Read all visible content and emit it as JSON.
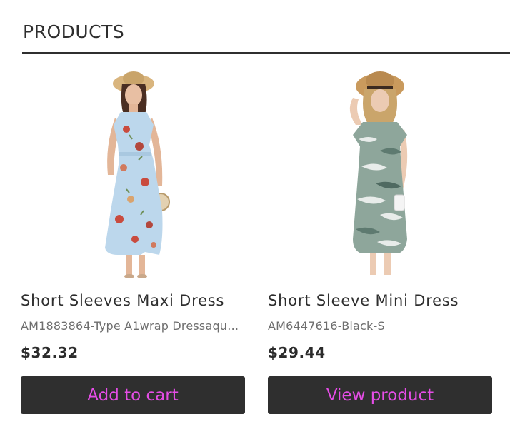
{
  "section": {
    "title": "PRODUCTS"
  },
  "products": [
    {
      "name": "Short Sleeves Maxi Dress",
      "sku": "AM1883864-Type A1wrap Dressaqu…",
      "price": "$32.32",
      "button_label": "Add to cart",
      "image_icon": "floral-maxi-dress-photo"
    },
    {
      "name": "Short Sleeve Mini Dress",
      "sku": "AM6447616-Black-S",
      "price": "$29.44",
      "button_label": "View product",
      "image_icon": "camo-mini-dress-photo"
    }
  ],
  "colors": {
    "button_bg": "#2f2f2f",
    "button_text": "#e54de6",
    "rule": "#2f2f2f"
  }
}
